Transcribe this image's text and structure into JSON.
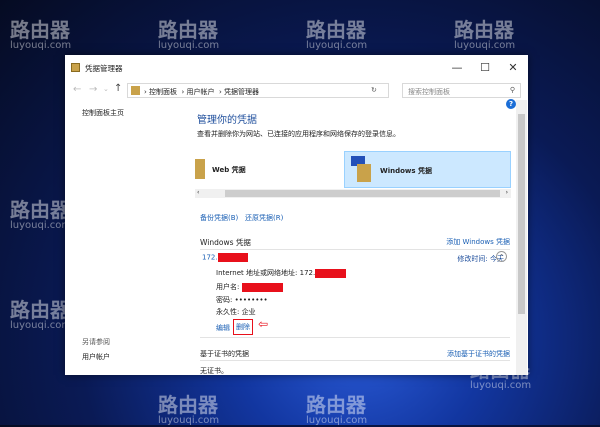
{
  "watermark": {
    "brand": "路由器",
    "url": "luyouqi.com"
  },
  "window": {
    "title": "凭据管理器",
    "minimize": "—",
    "maximize": "☐",
    "close": "✕"
  },
  "address": {
    "crumbs": [
      "控制面板",
      "用户帐户",
      "凭据管理器"
    ],
    "search_placeholder": "搜索控制面板"
  },
  "sidebar": {
    "home": "控制面板主页",
    "see_also": "另请参阅",
    "user_accounts": "用户帐户"
  },
  "main": {
    "title": "管理你的凭据",
    "description": "查看并删除你为网站、已连接的应用程序和网络保存的登录信息。",
    "tiles": [
      {
        "label": "Web 凭据"
      },
      {
        "label": "Windows 凭据",
        "selected": true
      }
    ],
    "backup": "备份凭据(B)",
    "restore": "还原凭据(R)",
    "windows_section": {
      "title": "Windows 凭据",
      "add": "添加 Windows 凭据",
      "entry": {
        "name": "172.",
        "modified_label": "修改时间:",
        "modified": "今天",
        "address_label": "Internet 地址或网络地址:",
        "address": "172.",
        "user_label": "用户名:",
        "password_label": "密码:",
        "password": "••••••••",
        "persistence_label": "永久性:",
        "persistence": "企业",
        "edit": "编辑",
        "delete": "删除"
      }
    },
    "cert_section": {
      "title": "基于证书的凭据",
      "add": "添加基于证书的凭据",
      "empty": "无证书。"
    }
  },
  "colors": {
    "accent": "#1a5fb4",
    "redaction": "#e8101b",
    "tile_selected": "#cce8ff"
  }
}
